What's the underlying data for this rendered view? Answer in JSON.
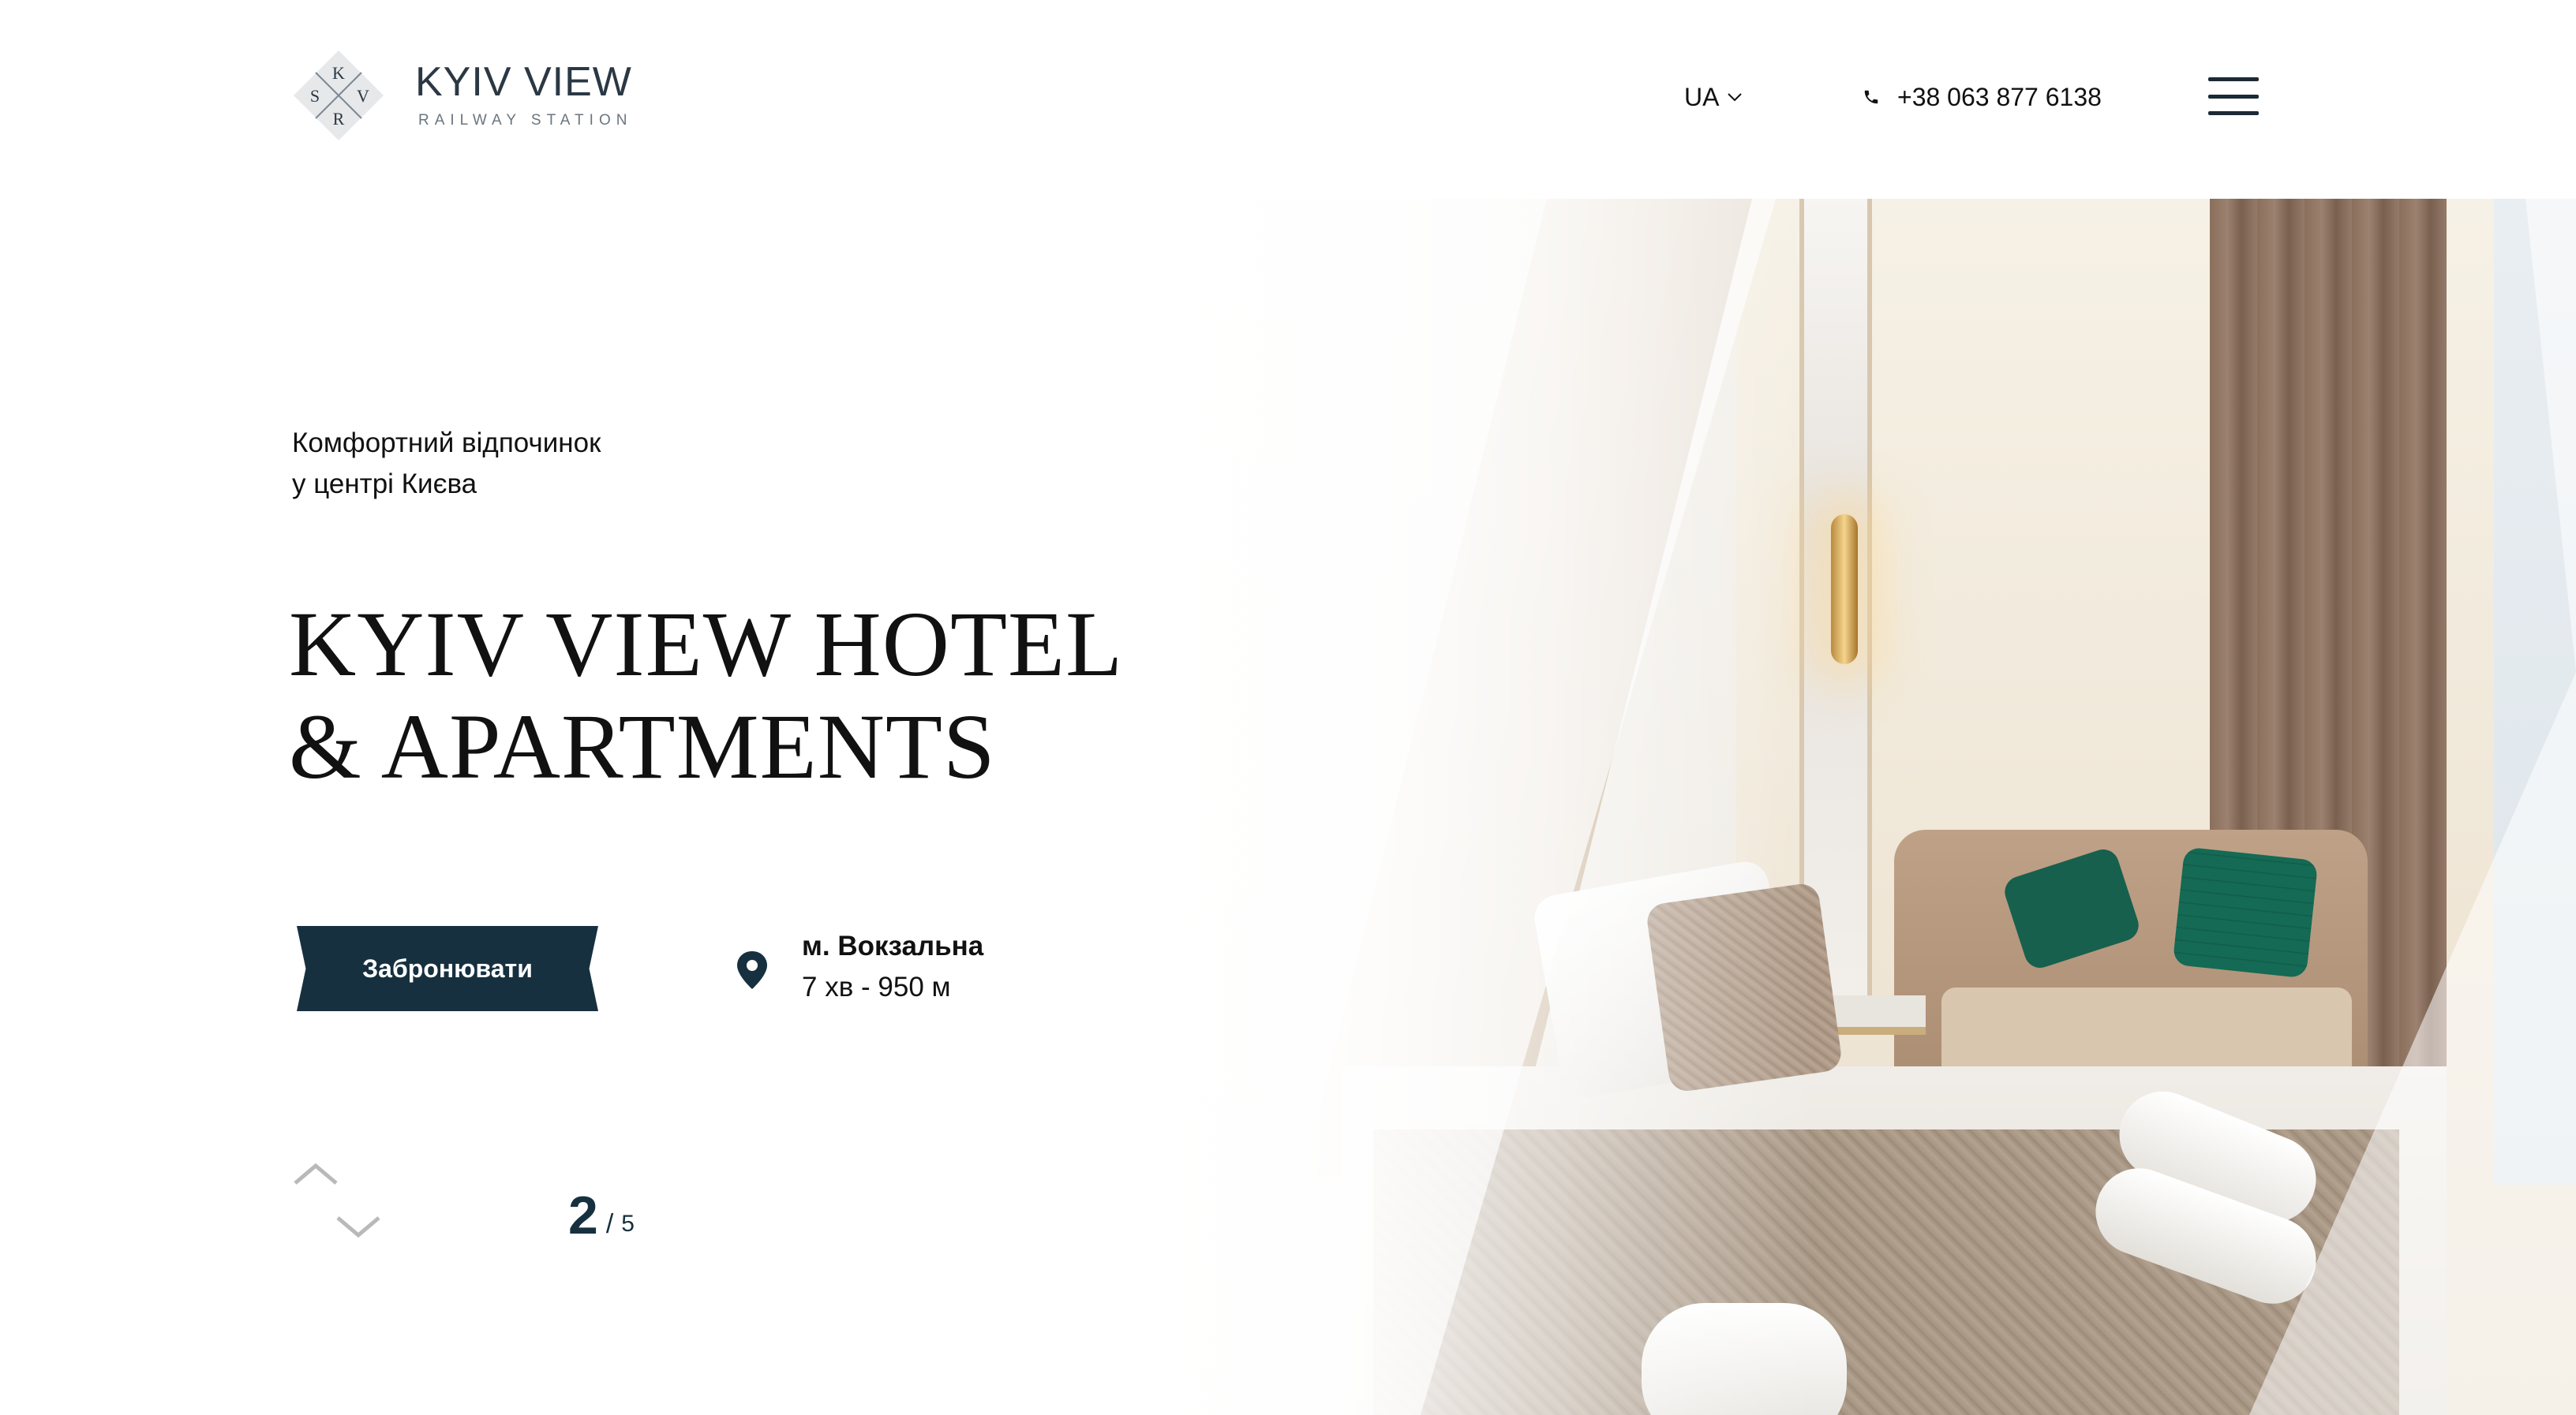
{
  "header": {
    "logo": {
      "monogram": [
        "K",
        "S",
        "V",
        "R"
      ],
      "title": "KYIV VIEW",
      "subtitle": "RAILWAY STATION"
    },
    "language": "UA",
    "phone": "+38 063 877 6138",
    "menu_icon": "hamburger-menu-icon"
  },
  "hero": {
    "tagline_line1": "Комфортний відпочинок",
    "tagline_line2": "у центрі Києва",
    "title_line1": "KYIV VIEW HOTEL",
    "title_line2": "& APARTMENTS",
    "book_button": "Забронювати",
    "location": {
      "icon": "map-pin-icon",
      "station": "м. Вокзальна",
      "distance": "7 хв - 950 м"
    },
    "slider": {
      "current": "2",
      "separator": "/",
      "total": "5"
    }
  },
  "colors": {
    "brand_dark": "#16303f",
    "text": "#111111",
    "logo_text": "#2b3844",
    "nav_arrows": "#b9b9b9"
  }
}
